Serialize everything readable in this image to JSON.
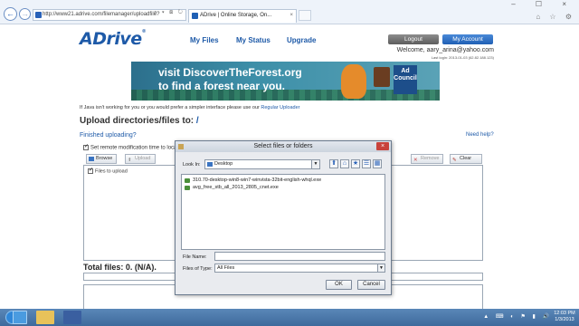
{
  "browser": {
    "back_label": "←",
    "forward_label": "→",
    "address": "http://www21.adrive.com/filemanager/uploadfile?",
    "address_icons": "⌕ ▾ ⊠ ↻ ×",
    "tab_title": "ADrive | Online Storage, On...",
    "tab_close": "×",
    "window_controls": "– ☐ ×",
    "right_icons": "⌂ ☆ ⚙"
  },
  "site": {
    "logo": "ADrive",
    "logo_tm": "®",
    "nav": [
      "My Files",
      "My Status",
      "Upgrade"
    ],
    "logout": "Logout",
    "my_account": "My Account",
    "welcome": "Welcome, aary_arina@yahoo.com",
    "last_login": "Last login: 2013-01-03 (62.82.188.123)"
  },
  "banner": {
    "line1": "visit DiscoverTheForest.org",
    "line2": "to find a forest near you.",
    "ad_council": "Ad Council"
  },
  "upload": {
    "java_note": "If Java isn't working for you or you would prefer a simpler interface please use our",
    "java_link": "Regular Uploader",
    "heading": "Upload directories/files to:",
    "heading_path": "/",
    "finished": "Finished uploading?",
    "need_help": "Need help?",
    "set_remote": "Set remote modification time to loca",
    "browse": "Browse",
    "upload_btn": "Upload",
    "remove": "Remove",
    "clear": "Clear",
    "files_to_upload": "Files to upload",
    "total_files": "Total files: 0. (N/A)."
  },
  "dialog": {
    "title": "Select files or folders",
    "close": "×",
    "look_in_label": "Look In:",
    "look_in_value": "Desktop",
    "tool_icons": [
      "⬆",
      "⌂",
      "★",
      "☰",
      "▦"
    ],
    "files": [
      "310.70-desktop-win8-win7-winvista-32bit-english-whql.exe",
      "avg_free_stb_all_2013_2805_cnet.exe"
    ],
    "file_name_label": "File Name:",
    "file_name_value": "",
    "files_of_type_label": "Files of Type:",
    "files_of_type_value": "All Files",
    "ok": "OK",
    "cancel": "Cancel"
  },
  "taskbar": {
    "tray": "▲ ⌨ ◐ ⚑ ▮ 🔊",
    "time": "12:03 PM",
    "date": "1/3/2013"
  }
}
